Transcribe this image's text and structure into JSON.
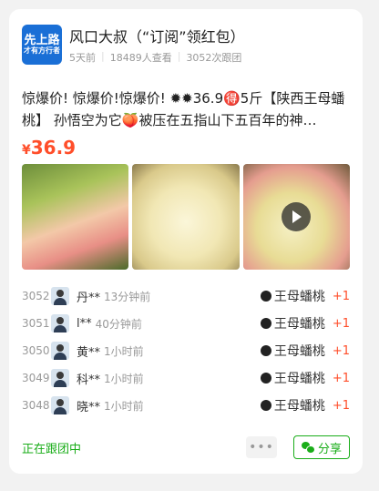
{
  "group": {
    "logo_line1": "先上路",
    "logo_line2": "才有方行者",
    "title": "风口大叔（“订阅”领红包）",
    "posted": "5天前",
    "views": "18489人查看",
    "follows": "3052次跟团"
  },
  "post": {
    "headline": "惊爆价! 惊爆价!惊爆价! ✹✹36.9🉐5斤【陕西王母蟠桃】 孙悟空为它🍑被压在五指山下五百年的神…",
    "currency": "¥",
    "price": "36.9"
  },
  "orders": [
    {
      "num": "3052",
      "name": "丹**",
      "time": "13分钟前",
      "product": "王母蟠桃",
      "qty": "+1"
    },
    {
      "num": "3051",
      "name": "l**",
      "time": "40分钟前",
      "product": "王母蟠桃",
      "qty": "+1"
    },
    {
      "num": "3050",
      "name": "黄**",
      "time": "1小时前",
      "product": "王母蟠桃",
      "qty": "+1"
    },
    {
      "num": "3049",
      "name": "科**",
      "time": "1小时前",
      "product": "王母蟠桃",
      "qty": "+1"
    },
    {
      "num": "3048",
      "name": "晓**",
      "time": "1小时前",
      "product": "王母蟠桃",
      "qty": "+1"
    }
  ],
  "footer": {
    "status": "正在跟团中",
    "more": "•••",
    "share": "分享"
  }
}
